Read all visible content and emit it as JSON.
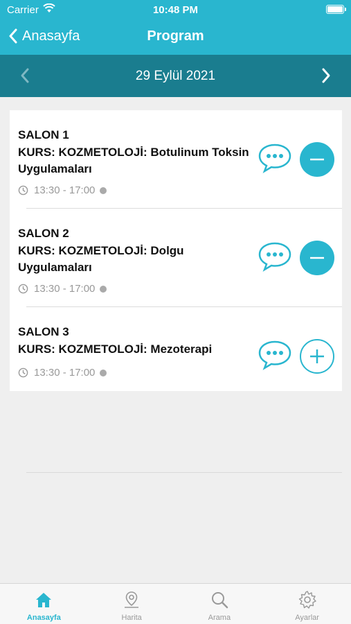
{
  "status_bar": {
    "carrier": "Carrier",
    "time": "10:48 PM"
  },
  "nav": {
    "back_label": "Anasayfa",
    "title": "Program"
  },
  "date_bar": {
    "date": "29 Eylül 2021"
  },
  "sessions": [
    {
      "salon": "SALON 1",
      "course": "KURS: KOZMETOLOJİ: Botulinum Toksin Uygulamaları",
      "time": "13:30 - 17:00",
      "action": "remove"
    },
    {
      "salon": "SALON 2",
      "course": "KURS: KOZMETOLOJİ: Dolgu Uygulamaları",
      "time": "13:30 - 17:00",
      "action": "remove"
    },
    {
      "salon": "SALON 3",
      "course": "KURS: KOZMETOLOJİ: Mezoterapi",
      "time": "13:30 - 17:00",
      "action": "add"
    }
  ],
  "tabs": [
    {
      "label": "Anasayfa",
      "icon": "home-icon",
      "active": true
    },
    {
      "label": "Harita",
      "icon": "map-pin-icon",
      "active": false
    },
    {
      "label": "Arama",
      "icon": "search-icon",
      "active": false
    },
    {
      "label": "Ayarlar",
      "icon": "gear-icon",
      "active": false
    }
  ],
  "colors": {
    "accent": "#29b6cf",
    "date_bar": "#1a7d8f",
    "background": "#efefef"
  }
}
